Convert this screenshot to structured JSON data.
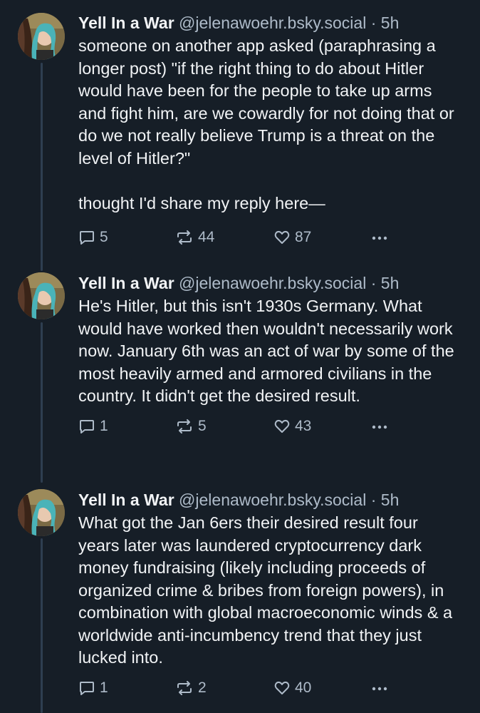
{
  "posts": [
    {
      "author_name": "Yell In a War",
      "handle": "@jelenawoehr.bsky.social",
      "separator": "·",
      "time": "5h",
      "text": "someone on another app asked (paraphrasing a longer post) \"if the right thing to do about Hitler would have been for the people to take up arms and fight him, are we cowardly for not doing that or do we not really believe Trump is a threat on the level of Hitler?\"\n\nthought I'd share my reply here—",
      "reply_count": "5",
      "repost_count": "44",
      "like_count": "87"
    },
    {
      "author_name": "Yell In a War",
      "handle": "@jelenawoehr.bsky.social",
      "separator": "·",
      "time": "5h",
      "text": "He's Hitler, but this isn't 1930s Germany. What would have worked then wouldn't necessarily work now. January 6th was an act of war by some of the most heavily armed and armored civilians in the country. It didn't get the desired result.",
      "reply_count": "1",
      "repost_count": "5",
      "like_count": "43"
    },
    {
      "author_name": "Yell In a War",
      "handle": "@jelenawoehr.bsky.social",
      "separator": "·",
      "time": "5h",
      "text": "What got the Jan 6ers their desired result four years later was laundered cryptocurrency dark money fundraising (likely including proceeds of organized crime & bribes from foreign powers), in combination with global macroeconomic winds & a worldwide anti-incumbency trend that they just lucked into.",
      "reply_count": "1",
      "repost_count": "2",
      "like_count": "40"
    }
  ],
  "colors": {
    "background": "#161e27",
    "text": "#f1f3f5",
    "muted": "#aebbc9",
    "thread_line": "#2e3e50"
  },
  "icons": [
    "reply-icon",
    "repost-icon",
    "like-icon",
    "more-icon"
  ]
}
